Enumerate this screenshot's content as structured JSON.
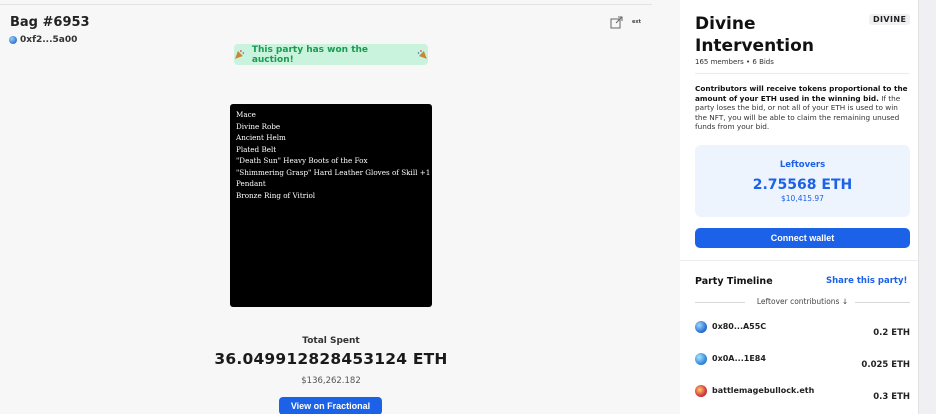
{
  "nft": {
    "title": "Bag #6953",
    "owner_address": "0xf2...5a00",
    "won_banner": "This party has won the auction!",
    "items": [
      "Mace",
      "Divine Robe",
      "Ancient Helm",
      "Plated Belt",
      "\"Death Sun\" Heavy Boots of the Fox",
      "\"Shimmering Grasp\" Hard Leather Gloves of Skill +1",
      "Pendant",
      "Bronze Ring of Vitriol"
    ],
    "total_spent_label": "Total Spent",
    "total_spent_eth": "36.049912828453124 ETH",
    "total_spent_usd": "$136,262.182",
    "view_button": "View on Fractional",
    "external_label": "ext"
  },
  "party": {
    "name": "Divine Intervention",
    "badge": "DIVINE",
    "meta": "165 members • 6 Bids",
    "info_bold": "Contributors will receive tokens proportional to the amount of your ETH used in the winning bid.",
    "info_rest": " If the party loses the bid, or not all of your ETH is used to win the NFT, you will be able to claim the remaining unused funds from your bid.",
    "leftovers_label": "Leftovers",
    "leftovers_eth": "2.75568 ETH",
    "leftovers_usd": "$10,415.97",
    "connect_button": "Connect wallet"
  },
  "timeline": {
    "title": "Party Timeline",
    "share_link": "Share this party!",
    "section_label": "Leftover contributions ↓",
    "rows": [
      {
        "name": "0x80...A55C",
        "amount": "0.2 ETH"
      },
      {
        "name": "0x0A...1E84",
        "amount": "0.025 ETH"
      },
      {
        "name": "battlemagebullock.eth",
        "amount": "0.3 ETH"
      }
    ]
  },
  "colors": {
    "accent": "#1b62e8",
    "success_text": "#1b9a52",
    "success_bg": "#c9f3dc",
    "nft_bg": "#000000"
  },
  "icons": [
    "share-icon",
    "party-popper-icon"
  ]
}
